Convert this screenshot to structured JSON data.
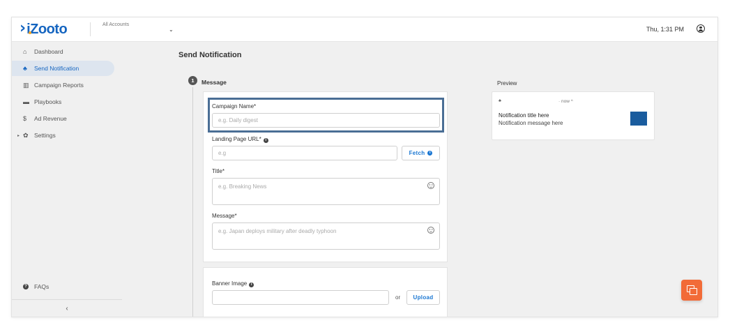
{
  "header": {
    "logo_text": "iZooto",
    "account_label": "All Accounts",
    "account_caret": "⌄",
    "clock": "Thu, 1:31 PM"
  },
  "sidebar": {
    "items": [
      {
        "label": "Dashboard",
        "icon": "home-icon",
        "glyph": "⌂"
      },
      {
        "label": "Send Notification",
        "icon": "bell-icon",
        "glyph": "♣"
      },
      {
        "label": "Campaign Reports",
        "icon": "bar-chart-icon",
        "glyph": "▥"
      },
      {
        "label": "Playbooks",
        "icon": "playbook-icon",
        "glyph": "▬"
      },
      {
        "label": "Ad Revenue",
        "icon": "dollar-icon",
        "glyph": "$"
      },
      {
        "label": "Settings",
        "icon": "gear-icon",
        "glyph": "✿"
      }
    ],
    "faq_label": "FAQs",
    "collapse_glyph": "‹"
  },
  "main": {
    "page_title": "Send Notification",
    "step_number": "1",
    "step_label": "Message",
    "campaign_name_label": "Campaign Name*",
    "campaign_name_placeholder": "e.g. Daily digest",
    "landing_url_label": "Landing Page URL*",
    "landing_url_placeholder": "e.g",
    "fetch_label": "Fetch",
    "title_label": "Title*",
    "title_placeholder": "e.g. Breaking News",
    "message_label": "Message*",
    "message_placeholder": "e.g. Japan deploys military after deadly typhoon",
    "banner_label": "Banner Image",
    "or_text": "or",
    "upload_label": "Upload"
  },
  "preview": {
    "label": "Preview",
    "time": "· now ^",
    "title": "Notification title here",
    "message": "Notification message here"
  },
  "colors": {
    "brand": "#1565c0",
    "accent_orange": "#f26b38",
    "highlight_border": "#4a6e95",
    "active_nav_bg": "#dde5ef"
  }
}
